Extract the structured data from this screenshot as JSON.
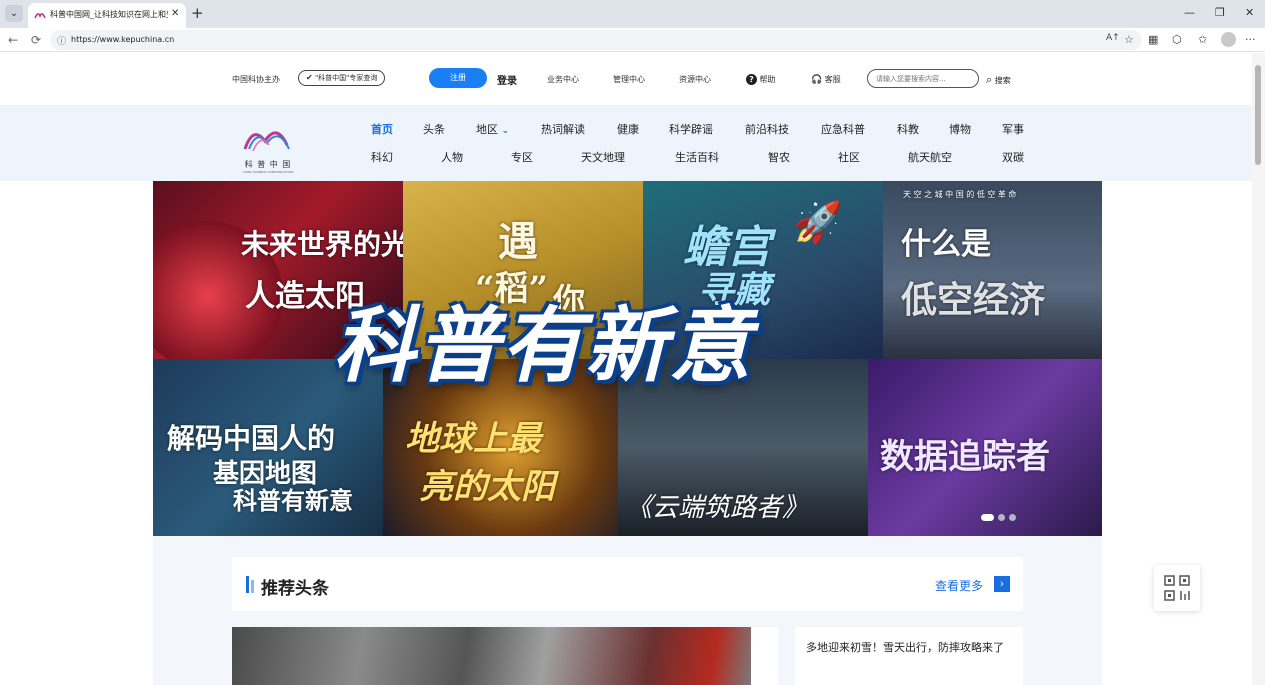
{
  "browser": {
    "tab_title": "科普中国网_让科技知识在网上和生",
    "tab_close": "✕",
    "new_tab": "+",
    "url": "https://www.kepuchina.cn",
    "minimize": "—",
    "maximize": "❐",
    "close": "✕"
  },
  "topbar": {
    "host": "中国科协主办",
    "expert_query": "\"科普中国\"专家查询",
    "register": "注册",
    "login": "登录",
    "business_center": "业务中心",
    "admin_center": "管理中心",
    "resource_center": "资源中心",
    "help": "帮助",
    "service": "客服",
    "search_placeholder": "请输入您要搜索内容...",
    "search_button": "搜索"
  },
  "logo": {
    "cn": "科 普 中 国",
    "en": "CHINA SCIENCE COMMUNICATION"
  },
  "nav": {
    "row1": [
      "首页",
      "头条",
      "地区",
      "热词解读",
      "健康",
      "科学辟谣",
      "前沿科技",
      "应急科普",
      "科教",
      "博物",
      "军事"
    ],
    "row2": [
      "科幻",
      "人物",
      "专区",
      "天文地理",
      "生活百科",
      "智农",
      "社区",
      "航天航空",
      "双碳"
    ],
    "active": "首页"
  },
  "banner": {
    "main_title": "科普有新意",
    "p1_line1": "未来世界的光",
    "p1_line2": "人造太阳",
    "p2_a": "遇",
    "p2_b": "“稻”",
    "p2_c": "你",
    "p3_line1": "蟾宫",
    "p3_line2": "寻藏",
    "p4_top": "天 空 之 城     中 国 的 低 空 革 命",
    "p4_line1": "什么是",
    "p4_line2": "低空经济",
    "p5_line1": "解码中国人的",
    "p5_line2": "基因地图",
    "p5_line3": "科普有新意",
    "p6_line1": "地球上最",
    "p6_line2": "亮的太阳",
    "p7": "《云端筑路者》",
    "p8": "数据追踪者",
    "slides": 3,
    "active_slide": 1
  },
  "recommend": {
    "title": "推荐头条",
    "more": "查看更多",
    "more_icon": "›",
    "news_text": "多地迎来初雪！雪天出行，防摔攻略来了"
  },
  "icons": {
    "tab_favicon": "kepuchina-logo-icon",
    "back": "←",
    "refresh": "⟳",
    "lock": "🔒",
    "help": "?",
    "service": "headset-icon",
    "search": "⌕",
    "qr": "qr-code-icon"
  },
  "colors": {
    "accent": "#1a7ff5",
    "nav_active": "#1a6fe0",
    "nav_band": "#eef4fc"
  }
}
